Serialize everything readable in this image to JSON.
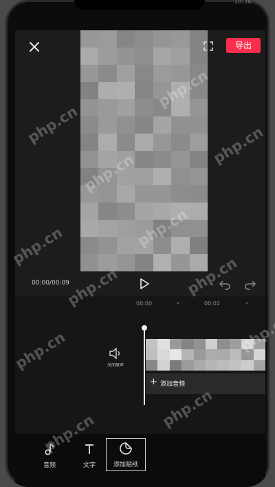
{
  "status_bar": {
    "time": "10:36"
  },
  "header": {
    "export_label": "导出"
  },
  "player": {
    "time_readout": "00:00/00:09"
  },
  "timeline": {
    "ruler": [
      "00:00",
      "00:02"
    ],
    "mute_label": "关闭原声",
    "add_audio_label": "添加音频"
  },
  "toolbar": {
    "items": [
      {
        "label": "音频",
        "icon": "music-note-icon"
      },
      {
        "label": "文字",
        "icon": "text-icon"
      },
      {
        "label": "添加贴纸",
        "icon": "sticker-icon",
        "selected": true
      }
    ]
  },
  "watermark": {
    "text": "php.cn"
  },
  "colors": {
    "accent": "#fa2e4c",
    "background": "#1c1c1c"
  }
}
